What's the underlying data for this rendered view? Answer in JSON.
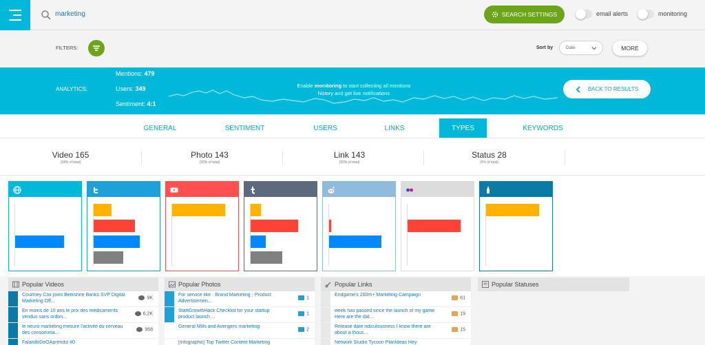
{
  "search": {
    "query": "marketing"
  },
  "header": {
    "search_settings_label": "SEARCH SETTINGS",
    "email_alerts_label": "email alerts",
    "monitoring_label": "monitoring"
  },
  "filters": {
    "label": "FILTERS:",
    "sort_by_label": "Sort by",
    "sort_value": "Date",
    "more_label": "MORE"
  },
  "analytics": {
    "label": "ANALYTICS:",
    "mentions_label": "Mentions:",
    "mentions": "479",
    "users_label": "Users:",
    "users": "349",
    "sentiment_label": "Sentiment:",
    "sentiment": "4:1",
    "monitor_pre": "Enable ",
    "monitor_bold": "monitoring",
    "monitor_post": " to start collecting all mentions history and get live notifications",
    "back_label": "BACK TO RESULTS"
  },
  "tabs": [
    "GENERAL",
    "SENTIMENT",
    "USERS",
    "LINKS",
    "TYPES",
    "KEYWORDS"
  ],
  "active_tab": "TYPES",
  "types": [
    {
      "label": "Video 165",
      "sub": "(34% of total)"
    },
    {
      "label": "Photo 143",
      "sub": "(30% of total)"
    },
    {
      "label": "Link 143",
      "sub": "(30% of total)"
    },
    {
      "label": "Status 28",
      "sub": "(6% of total)"
    }
  ],
  "colors": {
    "accent": "#00b8d9",
    "green": "#6ca51a",
    "video": "#0088ff",
    "photo": "#ffb300",
    "link": "#ff4136",
    "status": "#808080"
  },
  "networks": [
    {
      "name": "web-icon",
      "color": "#00b8d9",
      "bars": {
        "video": 0.82,
        "photo": 0,
        "link": 0,
        "status": 0
      }
    },
    {
      "name": "twitter-icon",
      "color": "#1da1d6",
      "bars": {
        "video": 0.78,
        "photo": 0.3,
        "link": 0.7,
        "status": 0.5
      }
    },
    {
      "name": "youtube-icon",
      "color": "#ff5050",
      "bars": {
        "video": 0,
        "photo": 0.9,
        "link": 0,
        "status": 0
      }
    },
    {
      "name": "tumblr-icon",
      "color": "#5b6b7d",
      "bars": {
        "video": 0.26,
        "photo": 0.18,
        "link": 0.8,
        "status": 0.54
      }
    },
    {
      "name": "reddit-icon",
      "color": "#8fbbdc",
      "bars": {
        "video": 0.88,
        "photo": 0,
        "link": 0.03,
        "status": 0
      }
    },
    {
      "name": "flickr-icon",
      "color": "#dcdcdc",
      "bars": {
        "video": 0,
        "photo": 0,
        "link": 0.9,
        "status": 0
      }
    },
    {
      "name": "news-icon",
      "color": "#0a7ba6",
      "bars": {
        "video": 0,
        "photo": 0.9,
        "link": 0,
        "status": 0
      }
    }
  ],
  "popular": {
    "videos": {
      "title": "Popular Videos",
      "items": [
        {
          "text": "Courtney Cox joins Berkshire Banks SVP Digital Marketing Off...",
          "meta": "9K"
        },
        {
          "text": "En moins de 10 ans le prix des médicaments vendus sans ordon...",
          "meta": "6.2K"
        },
        {
          "text": "le neuro marketing mesure l'activité du cerveau des consomma...",
          "meta": "958"
        },
        {
          "text": "FalandoDeOAprendiz #0",
          "meta": ""
        }
      ]
    },
    "photos": {
      "title": "Popular Photos",
      "items": [
        {
          "text": "For service like · Brand Marketing - Product Advertisemen...",
          "meta": "1"
        },
        {
          "text": "StartGrowthHack Checklist for your startup product launch ...",
          "meta": "1"
        },
        {
          "text": "General Mills and Avengers marketing",
          "meta": "2"
        },
        {
          "text": "[Infographic] Top Twitter Content Marketing Trends in 2019",
          "meta": ""
        }
      ]
    },
    "links": {
      "title": "Popular Links",
      "items": [
        {
          "text": "Endgame's 200m+ Marketing Campaign",
          "meta": "61"
        },
        {
          "text": "week has passed since the launch of my game Here are the dat...",
          "meta": "19"
        },
        {
          "text": "Release date ridiculousness I know there are about a thous...",
          "meta": "15"
        },
        {
          "text": "Network Studio Tycoon PlanIdeas Hey",
          "meta": ""
        }
      ]
    },
    "statuses": {
      "title": "Popular Statuses",
      "items": []
    }
  }
}
